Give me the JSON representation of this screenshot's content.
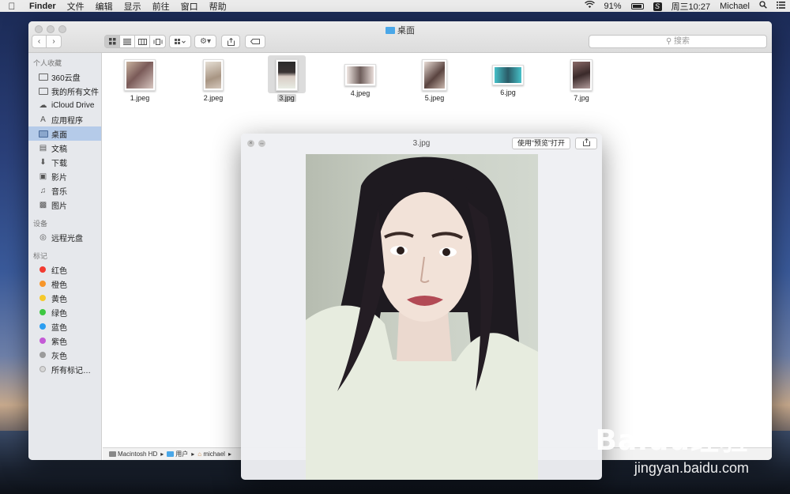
{
  "menubar": {
    "app_name": "Finder",
    "menus": [
      "文件",
      "编辑",
      "显示",
      "前往",
      "窗口",
      "帮助"
    ],
    "battery": "91%",
    "clock": "周三10:27",
    "user": "Michael"
  },
  "finder": {
    "title": "桌面",
    "search_placeholder": "搜索",
    "sidebar": {
      "favorites_header": "个人收藏",
      "favorites": [
        {
          "label": "360云盘",
          "icon": "folder-icon"
        },
        {
          "label": "我的所有文件",
          "icon": "all-files-icon"
        },
        {
          "label": "iCloud Drive",
          "icon": "cloud-icon"
        },
        {
          "label": "应用程序",
          "icon": "applications-icon"
        },
        {
          "label": "桌面",
          "icon": "desktop-icon"
        },
        {
          "label": "文稿",
          "icon": "documents-icon"
        },
        {
          "label": "下载",
          "icon": "download-icon"
        },
        {
          "label": "影片",
          "icon": "movies-icon"
        },
        {
          "label": "音乐",
          "icon": "music-icon"
        },
        {
          "label": "图片",
          "icon": "pictures-icon"
        }
      ],
      "devices_header": "设备",
      "devices": [
        {
          "label": "远程光盘",
          "icon": "disc-icon"
        }
      ],
      "tags_header": "标记",
      "tags": [
        {
          "label": "红色",
          "color": "#f23b31"
        },
        {
          "label": "橙色",
          "color": "#f7962b"
        },
        {
          "label": "黄色",
          "color": "#f6c92c"
        },
        {
          "label": "绿色",
          "color": "#3ec842"
        },
        {
          "label": "蓝色",
          "color": "#2c9ef1"
        },
        {
          "label": "紫色",
          "color": "#c45ad6"
        },
        {
          "label": "灰色",
          "color": "#9b9b9b"
        },
        {
          "label": "所有标记…",
          "color": "#d6d6d6"
        }
      ]
    },
    "files": [
      "1.jpeg",
      "2.jpeg",
      "3.jpg",
      "4.jpeg",
      "5.jpeg",
      "6.jpg",
      "7.jpg"
    ],
    "selected_file": "3.jpg",
    "path": [
      "Macintosh HD",
      "用户",
      "michael"
    ]
  },
  "quicklook": {
    "title": "3.jpg",
    "open_button": "使用“预览”打开"
  },
  "watermark": {
    "logo": "Baidu经验",
    "url": "jingyan.baidu.com"
  }
}
